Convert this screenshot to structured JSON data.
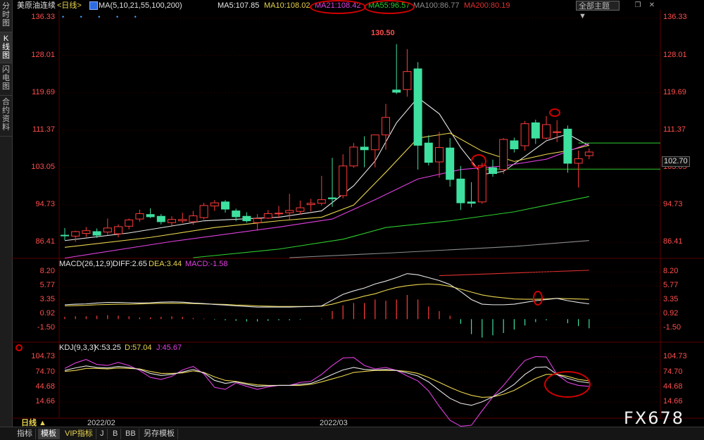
{
  "sidebar": {
    "items": [
      "分时图",
      "K线图",
      "闪电图",
      "合约资料"
    ],
    "active": 1
  },
  "header": {
    "symbol": "美原油连续",
    "period": "<日线>",
    "ma_params": "MA(5,10,21,55,100,200)",
    "ma_values": [
      {
        "text": "MA5:107.85",
        "color": "#e6e6e6"
      },
      {
        "text": "MA10:108.02",
        "color": "#e8d44d"
      },
      {
        "text": "MA21:108.42",
        "color": "#e040e0"
      },
      {
        "text": "MA55:96.57",
        "color": "#2ecc2e"
      },
      {
        "text": "MA100:86.77",
        "color": "#8c8c8c"
      },
      {
        "text": "MA200:80.19",
        "color": "#e03030"
      }
    ],
    "theme_select": "全部主题",
    "window_icons": [
      "chevron-down",
      "restore",
      "close"
    ]
  },
  "price_axis": {
    "ticks": [
      "136.33",
      "128.01",
      "119.69",
      "111.37",
      "103.05",
      "94.73",
      "86.41"
    ],
    "current_price": "102.70",
    "high_label": "130.50"
  },
  "date_labels": [
    "2022/02",
    "2022/03"
  ],
  "chart_data": [
    {
      "type": "candlestick",
      "ylim": [
        83.0,
        137.5
      ],
      "candles": [
        {
          "o": 88.0,
          "h": 89.6,
          "l": 86.9,
          "c": 87.9
        },
        {
          "o": 87.8,
          "h": 89.0,
          "l": 86.5,
          "c": 88.8
        },
        {
          "o": 88.4,
          "h": 89.8,
          "l": 87.6,
          "c": 89.0
        },
        {
          "o": 88.8,
          "h": 89.5,
          "l": 87.4,
          "c": 88.0
        },
        {
          "o": 88.7,
          "h": 91.7,
          "l": 88.1,
          "c": 89.6
        },
        {
          "o": 88.3,
          "h": 90.4,
          "l": 87.5,
          "c": 89.9
        },
        {
          "o": 90.0,
          "h": 91.7,
          "l": 89.3,
          "c": 91.4
        },
        {
          "o": 91.6,
          "h": 93.7,
          "l": 91.0,
          "c": 92.8
        },
        {
          "o": 92.6,
          "h": 94.0,
          "l": 91.8,
          "c": 92.1
        },
        {
          "o": 92.2,
          "h": 92.7,
          "l": 90.4,
          "c": 91.0
        },
        {
          "o": 90.8,
          "h": 92.2,
          "l": 90.1,
          "c": 91.5
        },
        {
          "o": 91.2,
          "h": 93.0,
          "l": 90.7,
          "c": 91.5
        },
        {
          "o": 91.0,
          "h": 93.4,
          "l": 90.3,
          "c": 92.3
        },
        {
          "o": 91.9,
          "h": 95.2,
          "l": 91.5,
          "c": 94.6
        },
        {
          "o": 94.5,
          "h": 95.8,
          "l": 93.4,
          "c": 95.2
        },
        {
          "o": 95.4,
          "h": 95.8,
          "l": 93.0,
          "c": 93.8
        },
        {
          "o": 93.4,
          "h": 93.9,
          "l": 91.1,
          "c": 92.1
        },
        {
          "o": 92.2,
          "h": 93.1,
          "l": 90.8,
          "c": 91.2
        },
        {
          "o": 90.8,
          "h": 92.7,
          "l": 89.0,
          "c": 91.7
        },
        {
          "o": 91.8,
          "h": 93.6,
          "l": 91.6,
          "c": 92.8
        },
        {
          "o": 92.8,
          "h": 94.5,
          "l": 91.8,
          "c": 92.9
        },
        {
          "o": 93.0,
          "h": 97.2,
          "l": 91.5,
          "c": 93.5
        },
        {
          "o": 93.3,
          "h": 95.7,
          "l": 92.6,
          "c": 94.1
        },
        {
          "o": 94.8,
          "h": 96.1,
          "l": 93.3,
          "c": 95.1
        },
        {
          "o": 95.1,
          "h": 101.2,
          "l": 94.6,
          "c": 95.9
        },
        {
          "o": 96.3,
          "h": 105.2,
          "l": 94.3,
          "c": 96.1
        },
        {
          "o": 96.8,
          "h": 106.0,
          "l": 96.2,
          "c": 103.4
        },
        {
          "o": 103.4,
          "h": 108.5,
          "l": 103.0,
          "c": 107.6
        },
        {
          "o": 107.6,
          "h": 110.0,
          "l": 103.1,
          "c": 107.0
        },
        {
          "o": 107.0,
          "h": 110.0,
          "l": 103.1,
          "c": 110.3
        },
        {
          "o": 110.3,
          "h": 117.2,
          "l": 107.0,
          "c": 114.2
        },
        {
          "o": 120.3,
          "h": 130.5,
          "l": 119.4,
          "c": 119.8
        },
        {
          "o": 120.4,
          "h": 129.4,
          "l": 118.8,
          "c": 124.4
        },
        {
          "o": 125.0,
          "h": 126.5,
          "l": 102.6,
          "c": 108.0
        },
        {
          "o": 108.5,
          "h": 110.2,
          "l": 103.5,
          "c": 104.2
        },
        {
          "o": 104.3,
          "h": 111.0,
          "l": 100.8,
          "c": 107.5
        },
        {
          "o": 107.4,
          "h": 109.6,
          "l": 98.8,
          "c": 100.4
        },
        {
          "o": 100.5,
          "h": 103.4,
          "l": 93.6,
          "c": 95.2
        },
        {
          "o": 95.4,
          "h": 99.8,
          "l": 94.2,
          "c": 95.1
        },
        {
          "o": 95.4,
          "h": 104.1,
          "l": 95.0,
          "c": 103.5
        },
        {
          "o": 103.0,
          "h": 104.8,
          "l": 101.0,
          "c": 101.7
        },
        {
          "o": 102.6,
          "h": 109.6,
          "l": 101.6,
          "c": 109.3
        },
        {
          "o": 109.0,
          "h": 109.7,
          "l": 106.4,
          "c": 107.2
        },
        {
          "o": 107.9,
          "h": 113.4,
          "l": 106.8,
          "c": 112.8
        },
        {
          "o": 113.0,
          "h": 113.7,
          "l": 108.3,
          "c": 109.6
        },
        {
          "o": 109.6,
          "h": 114.5,
          "l": 109.3,
          "c": 112.6
        },
        {
          "o": 111.0,
          "h": 113.6,
          "l": 108.7,
          "c": 111.0
        },
        {
          "o": 111.6,
          "h": 112.4,
          "l": 101.9,
          "c": 104.0
        },
        {
          "o": 104.0,
          "h": 106.8,
          "l": 98.6,
          "c": 105.0
        },
        {
          "o": 105.7,
          "h": 107.3,
          "l": 104.9,
          "c": 106.5
        }
      ],
      "moving_averages": [
        {
          "name": "MA5",
          "color": "#e6e6e6",
          "points": [
            [
              0,
              86.8
            ],
            [
              6,
              88.5
            ],
            [
              13,
              91.2
            ],
            [
              20,
              92.0
            ],
            [
              24,
              93.4
            ],
            [
              27,
              99.0
            ],
            [
              29,
              104.5
            ],
            [
              31,
              113.0
            ],
            [
              33,
              118.6
            ],
            [
              35,
              115.0
            ],
            [
              37,
              107.5
            ],
            [
              39,
              101.5
            ],
            [
              41,
              102.2
            ],
            [
              43,
              105.5
            ],
            [
              45,
              109.0
            ],
            [
              47,
              110.5
            ],
            [
              49,
              107.9
            ]
          ]
        },
        {
          "name": "MA10",
          "color": "#e8d44d",
          "points": [
            [
              0,
              85.3
            ],
            [
              8,
              87.5
            ],
            [
              14,
              89.7
            ],
            [
              20,
              91.2
            ],
            [
              24,
              92.0
            ],
            [
              27,
              94.7
            ],
            [
              30,
              102.0
            ],
            [
              33,
              109.6
            ],
            [
              36,
              110.7
            ],
            [
              39,
              106.7
            ],
            [
              42,
              104.4
            ],
            [
              45,
              106.0
            ],
            [
              47,
              106.8
            ],
            [
              49,
              108.0
            ]
          ]
        },
        {
          "name": "MA21",
          "color": "#e040e0",
          "points": [
            [
              0,
              82.9
            ],
            [
              10,
              86.6
            ],
            [
              20,
              89.8
            ],
            [
              25,
              91.6
            ],
            [
              29,
              95.9
            ],
            [
              33,
              100.5
            ],
            [
              37,
              102.6
            ],
            [
              41,
              103.4
            ],
            [
              45,
              104.9
            ],
            [
              49,
              108.4
            ]
          ]
        },
        {
          "name": "MA55",
          "color": "#2ecc2e",
          "points": [
            [
              12,
              83.0
            ],
            [
              20,
              84.9
            ],
            [
              26,
              87.1
            ],
            [
              30,
              89.7
            ],
            [
              36,
              91.2
            ],
            [
              42,
              93.2
            ],
            [
              49,
              96.6
            ]
          ]
        },
        {
          "name": "MA100",
          "color": "#8c8c8c",
          "points": [
            [
              21,
              83.0
            ],
            [
              30,
              84.0
            ],
            [
              42,
              85.5
            ],
            [
              49,
              86.8
            ]
          ]
        },
        {
          "name": "MA200",
          "color": "#e03030",
          "points": [
            [
              35,
              79.0
            ],
            [
              49,
              80.2
            ]
          ]
        }
      ],
      "reference_lines": [
        {
          "name": "support",
          "value": 102.7,
          "from": 39,
          "to": "end"
        },
        {
          "name": "resistance",
          "value": 108.5,
          "from": 48,
          "to": "end"
        }
      ]
    },
    {
      "type": "macd",
      "title": "MACD(26,12,9)",
      "legend": [
        {
          "text": "DIFF:2.65",
          "color": "#e6e6e6"
        },
        {
          "text": "DEA:3.44",
          "color": "#e8d44d"
        },
        {
          "text": "MACD:-1.58",
          "color": "#e040e0"
        }
      ],
      "ticks": [
        "8.20",
        "5.77",
        "3.35",
        "0.92",
        "-1.50"
      ],
      "ylim": [
        -3.5,
        9.2
      ],
      "diff": [
        2.5,
        2.6,
        2.65,
        2.8,
        2.9,
        2.9,
        2.85,
        2.8,
        2.85,
        2.95,
        3.0,
        2.95,
        2.8,
        2.7,
        2.55,
        2.45,
        2.3,
        2.2,
        2.1,
        2.1,
        2.1,
        2.1,
        2.15,
        2.2,
        2.3,
        3.3,
        4.3,
        4.9,
        5.4,
        6.1,
        6.6,
        7.2,
        7.9,
        7.7,
        7.2,
        6.7,
        6.0,
        4.8,
        3.4,
        2.6,
        2.5,
        2.5,
        2.6,
        2.9,
        3.2,
        3.4,
        3.6,
        3.2,
        2.9,
        2.65
      ],
      "dea": [
        2.3,
        2.35,
        2.4,
        2.5,
        2.55,
        2.6,
        2.6,
        2.65,
        2.7,
        2.75,
        2.75,
        2.75,
        2.7,
        2.65,
        2.6,
        2.55,
        2.45,
        2.4,
        2.3,
        2.25,
        2.2,
        2.2,
        2.2,
        2.2,
        2.25,
        2.6,
        3.1,
        3.5,
        4.0,
        4.4,
        5.0,
        5.5,
        5.8,
        6.0,
        6.1,
        6.0,
        5.7,
        5.2,
        4.7,
        4.2,
        3.9,
        3.7,
        3.5,
        3.45,
        3.45,
        3.5,
        3.6,
        3.55,
        3.5,
        3.44
      ],
      "macd": [
        0.4,
        0.5,
        0.5,
        0.6,
        0.7,
        0.6,
        0.5,
        0.3,
        0.3,
        0.4,
        0.5,
        0.4,
        0.2,
        0.1,
        -0.1,
        -0.2,
        -0.3,
        -0.4,
        -0.4,
        -0.3,
        -0.2,
        -0.2,
        -0.1,
        0.0,
        0.1,
        1.4,
        2.4,
        2.8,
        2.8,
        3.4,
        3.2,
        3.4,
        4.2,
        3.4,
        2.2,
        1.4,
        0.6,
        -0.8,
        -2.6,
        -3.2,
        -2.8,
        -2.4,
        -1.8,
        -1.1,
        -0.5,
        -0.2,
        0.0,
        -0.7,
        -1.2,
        -1.58
      ]
    },
    {
      "type": "kdj",
      "title": "KDJ(9,3,3)",
      "legend": [
        {
          "text": "K:53.25",
          "color": "#e6e6e6"
        },
        {
          "text": "D:57.04",
          "color": "#e8d44d"
        },
        {
          "text": "J:45.67",
          "color": "#e040e0"
        }
      ],
      "ticks": [
        "104.73",
        "74.70",
        "44.68",
        "14.66"
      ],
      "ylim": [
        -15,
        115
      ],
      "k": [
        78,
        83,
        87,
        84,
        83,
        86,
        84,
        80,
        72,
        68,
        70,
        75,
        80,
        73,
        58,
        52,
        55,
        50,
        46,
        47,
        48,
        48,
        50,
        52,
        60,
        70,
        79,
        84,
        80,
        79,
        80,
        78,
        73,
        67,
        55,
        38,
        22,
        12,
        8,
        15,
        25,
        36,
        50,
        70,
        84,
        85,
        70,
        62,
        56,
        53
      ],
      "d": [
        76,
        78,
        82,
        82,
        81,
        83,
        82,
        81,
        76,
        72,
        72,
        73,
        77,
        74,
        65,
        58,
        56,
        52,
        49,
        48,
        48,
        48,
        48,
        50,
        55,
        61,
        67,
        74,
        76,
        78,
        78,
        78,
        76,
        72,
        64,
        54,
        44,
        35,
        28,
        24,
        25,
        30,
        38,
        50,
        62,
        70,
        70,
        66,
        60,
        57
      ],
      "j": [
        82,
        93,
        100,
        90,
        88,
        94,
        88,
        78,
        64,
        60,
        66,
        79,
        86,
        71,
        44,
        40,
        53,
        46,
        40,
        45,
        48,
        48,
        54,
        56,
        70,
        88,
        103,
        104,
        88,
        81,
        84,
        78,
        67,
        57,
        37,
        6,
        -22,
        -34,
        -32,
        -3,
        25,
        48,
        74,
        98,
        106,
        105,
        70,
        54,
        48,
        46
      ]
    }
  ],
  "annotations": [
    "MA21 value highlighted",
    "MA55 value highlighted"
  ],
  "bottom_bar": {
    "period_label": "日线 ▲",
    "tabs": [
      "指标",
      "模板",
      "VIP指标",
      "J",
      "B",
      "BB",
      "另存模板"
    ],
    "active_tab": 1
  },
  "watermark": "FX678"
}
